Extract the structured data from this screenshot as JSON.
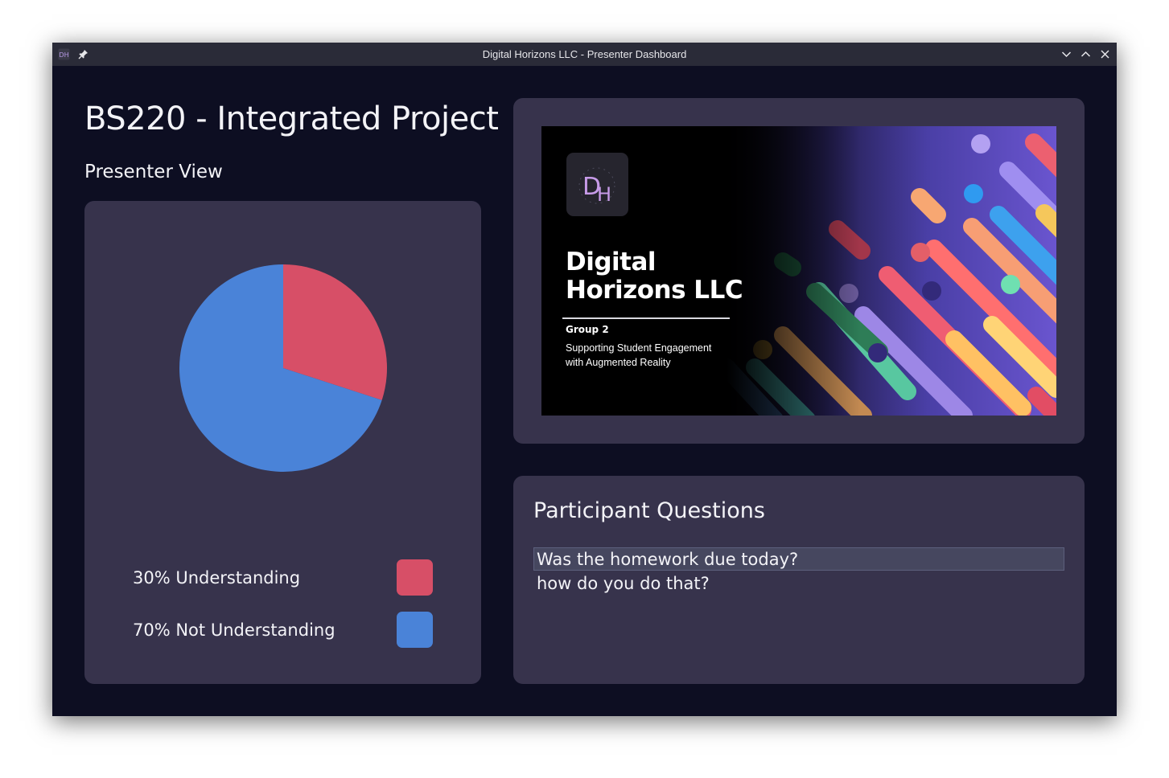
{
  "window": {
    "title": "Digital Horizons LLC - Presenter Dashboard",
    "app_icon": "dh-app-icon",
    "controls": [
      "pin-icon",
      "minimize-icon",
      "maximize-icon",
      "close-icon"
    ]
  },
  "header": {
    "title": "BS220 - Integrated Project",
    "subtitle": "Presenter View"
  },
  "chart_data": {
    "type": "pie",
    "categories": [
      "30% Understanding",
      "70% Not Understanding"
    ],
    "values": [
      30,
      70
    ],
    "colors": [
      "#d74f67",
      "#4a83d8"
    ],
    "legend_placement": "bottom"
  },
  "slide": {
    "logo_text": "DH",
    "title_line1": "Digital",
    "title_line2": "Horizons LLC",
    "group": "Group 2",
    "subtitle_line1": "Supporting Student Engagement",
    "subtitle_line2": "with Augmented Reality"
  },
  "questions": {
    "title": "Participant Questions",
    "items": [
      {
        "text": "Was the homework due today?",
        "selected": true
      },
      {
        "text": "how do you do that?",
        "selected": false
      }
    ]
  },
  "colors": {
    "background": "#0d0e22",
    "panel": "#37334c",
    "titlebar": "#2a2b38",
    "understanding": "#d74f67",
    "not_understanding": "#4a83d8",
    "selection": "#46475f"
  }
}
